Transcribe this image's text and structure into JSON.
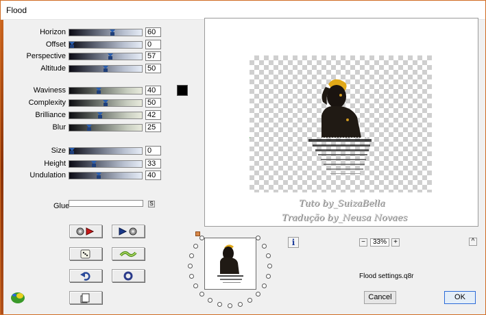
{
  "window": {
    "title": "Flood"
  },
  "params": {
    "group1": [
      {
        "label": "Horizon",
        "value": "60",
        "level": 0.6
      },
      {
        "label": "Offset",
        "value": "0",
        "level": 0.0
      },
      {
        "label": "Perspective",
        "value": "57",
        "level": 0.57
      },
      {
        "label": "Altitude",
        "value": "50",
        "level": 0.5
      }
    ],
    "group2": [
      {
        "label": "Waviness",
        "value": "40",
        "level": 0.4
      },
      {
        "label": "Complexity",
        "value": "50",
        "level": 0.5
      },
      {
        "label": "Brilliance",
        "value": "42",
        "level": 0.42
      },
      {
        "label": "Blur",
        "value": "25",
        "level": 0.25
      }
    ],
    "group3": [
      {
        "label": "Size",
        "value": "0",
        "level": 0.0
      },
      {
        "label": "Height",
        "value": "33",
        "level": 0.33
      },
      {
        "label": "Undulation",
        "value": "40",
        "level": 0.4
      }
    ]
  },
  "color": {
    "swatch": "#000000"
  },
  "glue": {
    "label": "Glue",
    "button": "S"
  },
  "preview": {
    "watermark_line1": "Tuto by_SuizaBella",
    "watermark_line2": "Tradução by_Neusa Novaes"
  },
  "info": {
    "icon": "info-icon",
    "label": "i"
  },
  "zoom": {
    "minus": "−",
    "value": "33%",
    "plus": "+"
  },
  "corner_button": "^",
  "settings_file": "Flood settings.q8r",
  "buttons": {
    "cancel": "Cancel",
    "ok": "OK"
  },
  "colors": {
    "accent": "#2a6ad8",
    "thumb": "#1f3f7a",
    "window_bg": "#f0f0f0"
  }
}
